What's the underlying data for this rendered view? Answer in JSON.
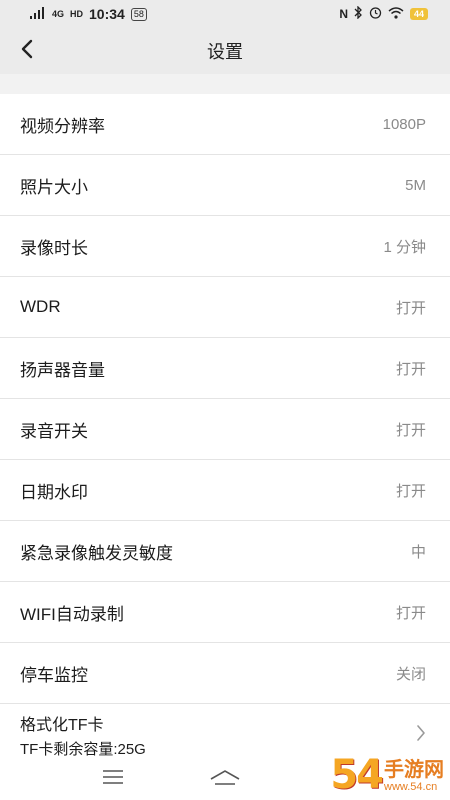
{
  "status_bar": {
    "network": "4G",
    "hd": "HD",
    "time": "10:34",
    "chip": "58",
    "battery": "44"
  },
  "header": {
    "title": "设置"
  },
  "settings": [
    {
      "label": "视频分辨率",
      "value": "1080P"
    },
    {
      "label": "照片大小",
      "value": "5M"
    },
    {
      "label": "录像时长",
      "value": "1 分钟"
    },
    {
      "label": "WDR",
      "value": "打开"
    },
    {
      "label": "扬声器音量",
      "value": "打开"
    },
    {
      "label": "录音开关",
      "value": "打开"
    },
    {
      "label": "日期水印",
      "value": "打开"
    },
    {
      "label": "紧急录像触发灵敏度",
      "value": "中"
    },
    {
      "label": "WIFI自动录制",
      "value": "打开"
    },
    {
      "label": "停车监控",
      "value": "关闭"
    }
  ],
  "format_sd": {
    "label": "格式化TF卡",
    "capacity": "TF卡剩余容量:25G"
  },
  "watermark": {
    "number": "54",
    "brand": "手游网",
    "site": "www.54.cn"
  }
}
